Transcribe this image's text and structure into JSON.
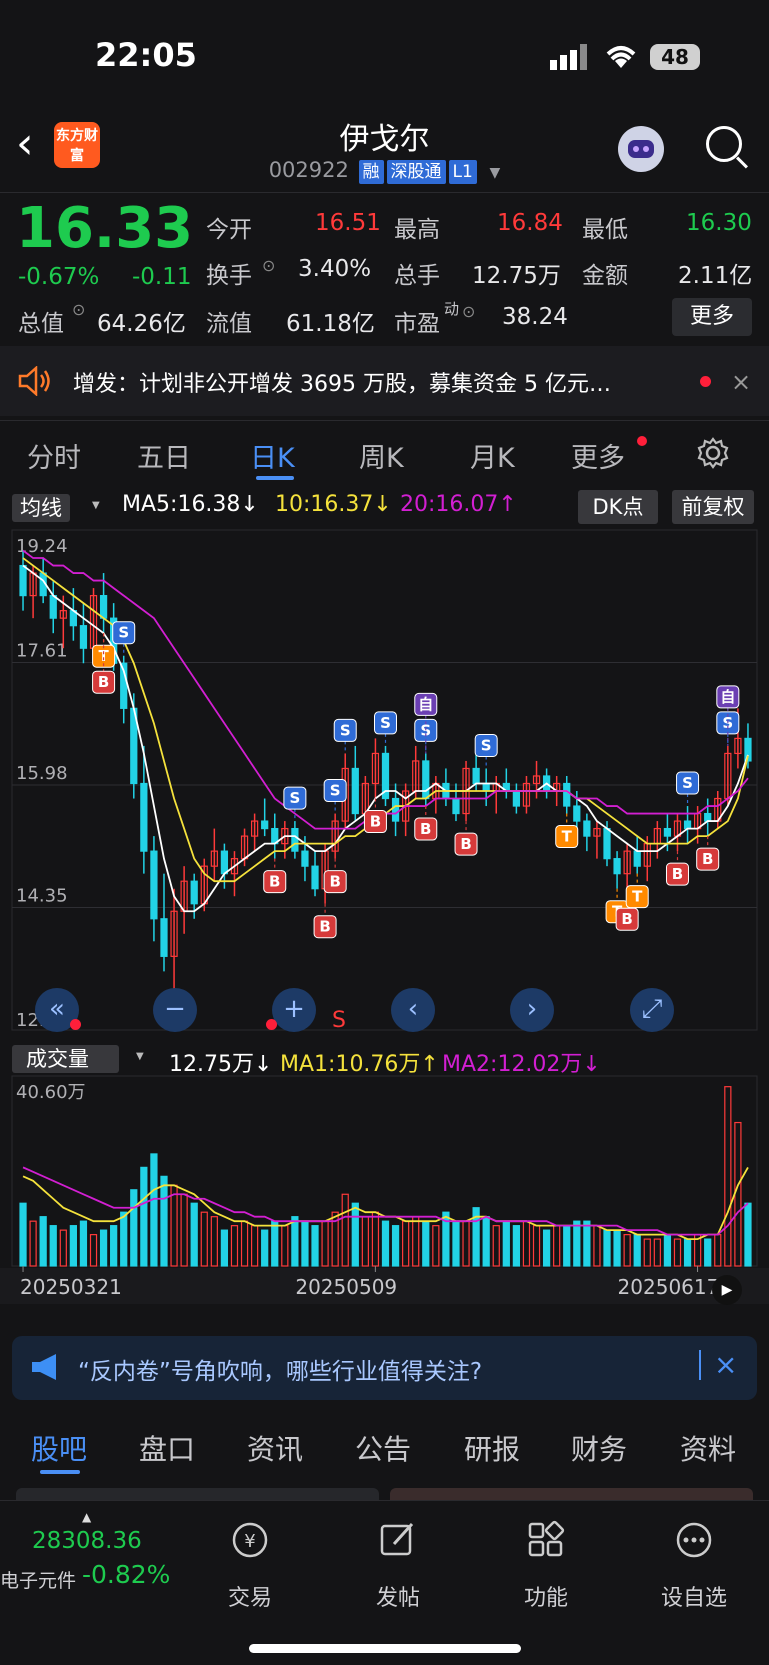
{
  "status": {
    "time": "22:05",
    "battery": "48"
  },
  "header": {
    "logo_text": "东方财富",
    "name": "伊戈尔",
    "code": "002922",
    "tags": [
      "融",
      "深股通",
      "L1"
    ]
  },
  "quote": {
    "price": "16.33",
    "pct": "-0.67%",
    "chg": "-0.11",
    "open_label": "今开",
    "open": "16.51",
    "high_label": "最高",
    "high": "16.84",
    "low_label": "最低",
    "low": "16.30",
    "turnover_label": "换手",
    "turnover": "3.40%",
    "vol_label": "总手",
    "vol": "12.75万",
    "amount_label": "金额",
    "amount": "2.11亿",
    "mktcap_label": "总值",
    "mktcap": "64.26亿",
    "float_label": "流值",
    "float": "61.18亿",
    "pe_label": "市盈",
    "pe_sup": "动",
    "pe": "38.24",
    "more": "更多"
  },
  "notice": {
    "text": "增发：计划非公开增发 3695 万股，募集资金 5 亿元…"
  },
  "tabs": [
    "分时",
    "五日",
    "日K",
    "周K",
    "月K",
    "更多"
  ],
  "ma_bar": {
    "selector": "均线",
    "ma5": "MA5:16.38↓",
    "ma10": "10:16.37↓",
    "ma20": "20:16.07↑",
    "dk": "DK点",
    "fq": "前复权"
  },
  "vol_bar": {
    "selector": "成交量",
    "v": "12.75万↓",
    "ma1": "MA1:10.76万↑",
    "ma2": "MA2:12.02万↓"
  },
  "colors": {
    "up": "#ff3a3a",
    "down": "#22d3e6",
    "ma5": "#ffffff",
    "ma10": "#f5e23c",
    "ma20": "#d21fd2",
    "accent": "#4a8ff5"
  },
  "chart_data": {
    "type": "candlestick",
    "y_ticks": [
      "19.24",
      "17.61",
      "15.98",
      "14.35",
      "12.72"
    ],
    "ylim": [
      12.72,
      19.24
    ],
    "volume_max_label": "40.60万",
    "x_ticks": [
      "20250321",
      "20250509",
      "20250617"
    ],
    "candles": [
      [
        18.9,
        19.1,
        18.3,
        18.5
      ],
      [
        18.5,
        18.9,
        18.2,
        18.8
      ],
      [
        18.8,
        19.0,
        18.4,
        18.5
      ],
      [
        18.5,
        18.7,
        18.0,
        18.2
      ],
      [
        18.2,
        18.5,
        17.8,
        18.3
      ],
      [
        18.3,
        18.6,
        17.9,
        18.1
      ],
      [
        18.1,
        18.4,
        17.6,
        17.8
      ],
      [
        17.8,
        18.6,
        17.7,
        18.5
      ],
      [
        18.5,
        18.8,
        18.0,
        18.2
      ],
      [
        18.2,
        18.4,
        17.5,
        17.6
      ],
      [
        17.6,
        17.7,
        16.8,
        17.0
      ],
      [
        17.0,
        17.2,
        15.8,
        16.0
      ],
      [
        16.0,
        16.5,
        14.8,
        15.1
      ],
      [
        15.1,
        15.3,
        13.9,
        14.2
      ],
      [
        14.2,
        14.8,
        13.5,
        13.7
      ],
      [
        13.7,
        14.6,
        12.72,
        14.3
      ],
      [
        14.3,
        14.9,
        14.0,
        14.7
      ],
      [
        14.7,
        14.8,
        14.2,
        14.4
      ],
      [
        14.4,
        15.0,
        14.3,
        14.9
      ],
      [
        14.9,
        15.4,
        14.7,
        15.1
      ],
      [
        15.1,
        15.2,
        14.6,
        14.8
      ],
      [
        14.8,
        15.1,
        14.5,
        15.0
      ],
      [
        15.0,
        15.4,
        14.9,
        15.3
      ],
      [
        15.3,
        15.6,
        15.1,
        15.5
      ],
      [
        15.5,
        15.8,
        15.3,
        15.4
      ],
      [
        15.4,
        15.6,
        15.0,
        15.2
      ],
      [
        15.2,
        15.5,
        15.0,
        15.4
      ],
      [
        15.4,
        15.5,
        15.0,
        15.1
      ],
      [
        15.1,
        15.3,
        14.7,
        14.9
      ],
      [
        14.9,
        15.1,
        14.5,
        14.6
      ],
      [
        14.6,
        15.2,
        14.4,
        15.1
      ],
      [
        15.1,
        15.6,
        15.0,
        15.5
      ],
      [
        15.5,
        16.4,
        15.4,
        16.2
      ],
      [
        16.2,
        16.5,
        15.5,
        15.6
      ],
      [
        15.6,
        16.1,
        15.4,
        16.0
      ],
      [
        16.0,
        16.6,
        15.8,
        16.4
      ],
      [
        16.4,
        16.5,
        15.7,
        15.8
      ],
      [
        15.8,
        16.0,
        15.3,
        15.5
      ],
      [
        15.5,
        16.0,
        15.3,
        15.9
      ],
      [
        15.9,
        16.5,
        15.8,
        16.3
      ],
      [
        16.3,
        16.4,
        15.7,
        15.8
      ],
      [
        15.8,
        16.1,
        15.6,
        16.0
      ],
      [
        16.0,
        16.2,
        15.7,
        15.8
      ],
      [
        15.8,
        16.0,
        15.5,
        15.6
      ],
      [
        15.6,
        16.3,
        15.5,
        16.2
      ],
      [
        16.2,
        16.6,
        15.9,
        16.0
      ],
      [
        16.0,
        16.2,
        15.7,
        15.9
      ],
      [
        15.9,
        16.1,
        15.6,
        16.0
      ],
      [
        16.0,
        16.2,
        15.8,
        15.9
      ],
      [
        15.9,
        16.0,
        15.6,
        15.7
      ],
      [
        15.7,
        16.1,
        15.6,
        16.0
      ],
      [
        16.0,
        16.3,
        15.8,
        16.1
      ],
      [
        16.1,
        16.2,
        15.8,
        15.9
      ],
      [
        15.9,
        16.1,
        15.7,
        16.0
      ],
      [
        16.0,
        16.1,
        15.6,
        15.7
      ],
      [
        15.7,
        15.9,
        15.4,
        15.5
      ],
      [
        15.5,
        15.6,
        15.1,
        15.3
      ],
      [
        15.3,
        15.5,
        15.0,
        15.4
      ],
      [
        15.4,
        15.5,
        14.9,
        15.0
      ],
      [
        15.0,
        15.1,
        14.6,
        14.8
      ],
      [
        14.8,
        15.2,
        14.5,
        15.1
      ],
      [
        15.1,
        15.3,
        14.8,
        14.9
      ],
      [
        14.9,
        15.3,
        14.7,
        15.2
      ],
      [
        15.2,
        15.5,
        15.0,
        15.4
      ],
      [
        15.4,
        15.6,
        15.1,
        15.3
      ],
      [
        15.3,
        15.6,
        15.1,
        15.5
      ],
      [
        15.5,
        15.7,
        15.2,
        15.4
      ],
      [
        15.4,
        15.7,
        15.2,
        15.6
      ],
      [
        15.6,
        15.8,
        15.3,
        15.5
      ],
      [
        15.5,
        15.9,
        15.4,
        15.8
      ],
      [
        15.8,
        16.5,
        15.7,
        16.4
      ],
      [
        16.4,
        17.0,
        16.2,
        16.6
      ],
      [
        16.6,
        16.8,
        16.2,
        16.3
      ]
    ],
    "ma_series": [
      {
        "name": "MA5",
        "values": [
          18.9,
          18.8,
          18.7,
          18.5,
          18.4,
          18.3,
          18.2,
          18.1,
          18.0,
          17.8,
          17.5,
          17.0,
          16.4,
          15.7,
          15.0,
          14.5,
          14.3,
          14.3,
          14.4,
          14.6,
          14.8,
          14.9,
          15.0,
          15.1,
          15.2,
          15.2,
          15.3,
          15.3,
          15.2,
          15.1,
          15.1,
          15.2,
          15.4,
          15.5,
          15.6,
          15.8,
          15.9,
          15.9,
          15.8,
          15.9,
          15.9,
          16.0,
          15.9,
          15.9,
          15.9,
          16.0,
          16.0,
          16.0,
          15.9,
          15.9,
          15.9,
          15.9,
          16.0,
          15.9,
          15.9,
          15.8,
          15.7,
          15.5,
          15.4,
          15.3,
          15.2,
          15.1,
          15.1,
          15.1,
          15.2,
          15.3,
          15.4,
          15.4,
          15.5,
          15.5,
          15.7,
          16.0,
          16.38
        ]
      },
      {
        "name": "MA10",
        "values": [
          19.0,
          18.9,
          18.8,
          18.7,
          18.6,
          18.5,
          18.4,
          18.3,
          18.2,
          18.1,
          17.9,
          17.6,
          17.2,
          16.8,
          16.3,
          15.8,
          15.4,
          15.0,
          14.8,
          14.7,
          14.7,
          14.7,
          14.8,
          14.9,
          15.0,
          15.1,
          15.1,
          15.2,
          15.2,
          15.2,
          15.2,
          15.2,
          15.3,
          15.3,
          15.4,
          15.5,
          15.6,
          15.7,
          15.7,
          15.8,
          15.8,
          15.9,
          15.9,
          15.9,
          15.9,
          15.9,
          15.9,
          15.9,
          15.9,
          15.9,
          15.9,
          15.9,
          15.9,
          15.9,
          15.9,
          15.8,
          15.8,
          15.7,
          15.6,
          15.5,
          15.4,
          15.3,
          15.2,
          15.2,
          15.2,
          15.2,
          15.2,
          15.3,
          15.3,
          15.4,
          15.5,
          15.8,
          16.37
        ]
      },
      {
        "name": "MA20",
        "values": [
          19.1,
          19.0,
          19.0,
          18.9,
          18.9,
          18.8,
          18.8,
          18.7,
          18.7,
          18.6,
          18.5,
          18.4,
          18.3,
          18.2,
          18.0,
          17.8,
          17.6,
          17.4,
          17.2,
          17.0,
          16.8,
          16.6,
          16.4,
          16.2,
          16.0,
          15.8,
          15.7,
          15.6,
          15.5,
          15.4,
          15.4,
          15.4,
          15.4,
          15.4,
          15.5,
          15.5,
          15.6,
          15.6,
          15.7,
          15.7,
          15.7,
          15.8,
          15.8,
          15.8,
          15.8,
          15.8,
          15.8,
          15.9,
          15.9,
          15.9,
          15.9,
          15.9,
          15.9,
          15.9,
          15.9,
          15.8,
          15.8,
          15.8,
          15.7,
          15.7,
          15.6,
          15.6,
          15.6,
          15.6,
          15.6,
          15.6,
          15.6,
          15.6,
          15.7,
          15.7,
          15.8,
          15.9,
          16.07
        ]
      }
    ],
    "signals": [
      {
        "i": 8,
        "t": "T",
        "side": "down",
        "c": "#ff8a00"
      },
      {
        "i": 8,
        "t": "B",
        "side": "down",
        "c": "#d63a3a"
      },
      {
        "i": 10,
        "t": "S",
        "side": "up",
        "c": "#2f6bd6"
      },
      {
        "i": 25,
        "t": "B",
        "side": "down",
        "c": "#d63a3a"
      },
      {
        "i": 27,
        "t": "S",
        "side": "up",
        "c": "#2f6bd6"
      },
      {
        "i": 30,
        "t": "B",
        "side": "down",
        "c": "#d63a3a"
      },
      {
        "i": 31,
        "t": "B",
        "side": "down",
        "c": "#d63a3a"
      },
      {
        "i": 31,
        "t": "S",
        "side": "up",
        "c": "#2f6bd6"
      },
      {
        "i": 32,
        "t": "S",
        "side": "up",
        "c": "#2f6bd6"
      },
      {
        "i": 35,
        "t": "B",
        "side": "down",
        "c": "#d63a3a"
      },
      {
        "i": 36,
        "t": "S",
        "side": "up",
        "c": "#2f6bd6"
      },
      {
        "i": 40,
        "t": "B",
        "side": "down",
        "c": "#d63a3a"
      },
      {
        "i": 40,
        "t": "S",
        "side": "up",
        "c": "#2f6bd6"
      },
      {
        "i": 40,
        "t": "自",
        "side": "up",
        "c": "#6b3fb3"
      },
      {
        "i": 44,
        "t": "B",
        "side": "down",
        "c": "#d63a3a"
      },
      {
        "i": 46,
        "t": "S",
        "side": "up",
        "c": "#2f6bd6"
      },
      {
        "i": 54,
        "t": "T",
        "side": "down",
        "c": "#ff8a00"
      },
      {
        "i": 59,
        "t": "T",
        "side": "down",
        "c": "#ff8a00"
      },
      {
        "i": 60,
        "t": "B",
        "side": "down",
        "c": "#d63a3a"
      },
      {
        "i": 61,
        "t": "T",
        "side": "down",
        "c": "#ff8a00"
      },
      {
        "i": 65,
        "t": "B",
        "side": "down",
        "c": "#d63a3a"
      },
      {
        "i": 66,
        "t": "S",
        "side": "up",
        "c": "#2f6bd6"
      },
      {
        "i": 68,
        "t": "B",
        "side": "down",
        "c": "#d63a3a"
      },
      {
        "i": 70,
        "t": "S",
        "side": "up",
        "c": "#2f6bd6"
      },
      {
        "i": 70,
        "t": "自",
        "side": "up",
        "c": "#6b3fb3"
      }
    ],
    "volume": [
      14,
      10,
      11,
      9,
      8,
      9,
      10,
      7,
      8,
      9,
      12,
      17,
      22,
      25,
      20,
      18,
      16,
      14,
      12,
      11,
      8,
      9,
      10,
      9,
      8,
      10,
      9,
      11,
      10,
      9,
      10,
      12,
      16,
      14,
      11,
      12,
      10,
      9,
      10,
      11,
      10,
      9,
      12,
      10,
      10,
      13,
      11,
      9,
      10,
      9,
      10,
      9,
      8,
      9,
      9,
      10,
      10,
      9,
      8,
      8,
      7,
      7,
      6,
      6,
      7,
      6,
      6,
      7,
      6,
      7,
      40,
      32,
      14
    ],
    "volume_ma1": [
      20,
      19,
      17,
      15,
      13,
      12,
      11,
      10,
      10,
      10,
      11,
      13,
      15,
      17,
      18,
      18,
      17,
      16,
      14,
      12,
      11,
      10,
      10,
      9,
      9,
      9,
      9,
      10,
      10,
      10,
      10,
      11,
      12,
      13,
      12,
      12,
      11,
      11,
      10,
      10,
      10,
      10,
      11,
      10,
      10,
      11,
      11,
      10,
      10,
      10,
      10,
      9,
      9,
      9,
      9,
      9,
      9,
      9,
      8,
      8,
      8,
      7,
      7,
      7,
      7,
      7,
      6,
      6,
      7,
      7,
      12,
      18,
      22
    ],
    "volume_ma2": [
      22,
      21,
      20,
      19,
      18,
      17,
      16,
      15,
      14,
      13,
      13,
      13,
      14,
      15,
      15,
      16,
      16,
      15,
      15,
      14,
      13,
      12,
      12,
      11,
      11,
      10,
      10,
      10,
      10,
      10,
      10,
      10,
      11,
      11,
      11,
      11,
      11,
      11,
      11,
      11,
      11,
      11,
      10,
      10,
      10,
      10,
      11,
      10,
      10,
      10,
      10,
      10,
      10,
      9,
      9,
      9,
      9,
      9,
      9,
      9,
      8,
      8,
      8,
      8,
      7,
      7,
      7,
      7,
      7,
      7,
      9,
      12,
      14
    ]
  },
  "chart_controls": {
    "s_label": "S"
  },
  "ad": {
    "text": "“反内卷”号角吹响，哪些行业值得关注?"
  },
  "bottom_tabs": [
    "股吧",
    "盘口",
    "资讯",
    "公告",
    "研报",
    "财务",
    "资料"
  ],
  "index": {
    "value": "28308.36",
    "name": "电子元件",
    "pct": "-0.82%"
  },
  "bottom_nav": [
    "交易",
    "发帖",
    "功能",
    "设自选"
  ]
}
